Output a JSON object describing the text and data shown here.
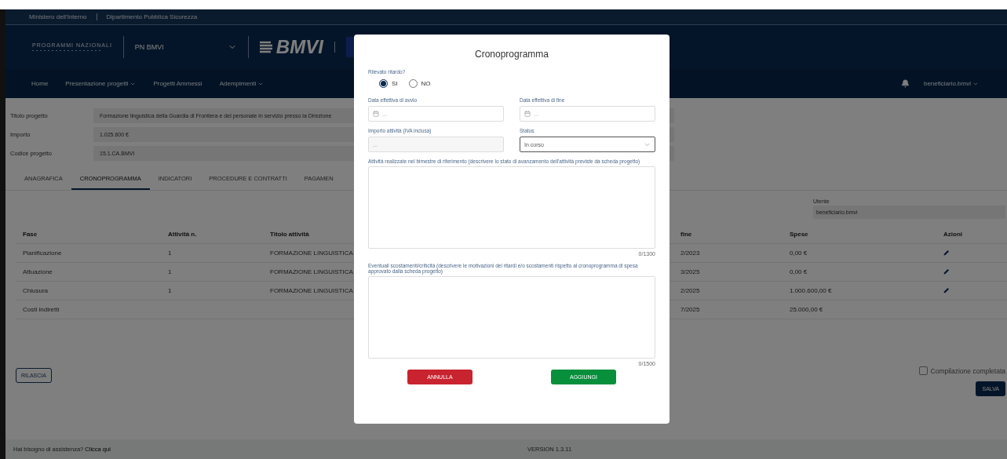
{
  "top_bar": {
    "items": [
      "Ministero dell'Interno",
      "Dipartimento Pubblica Sicurezza"
    ]
  },
  "header": {
    "program_logo": "PROGRAMMI NAZIONALI",
    "program_select": "PN BMVI",
    "brand": "BMVI"
  },
  "nav": {
    "items": [
      {
        "label": "Home",
        "dropdown": false
      },
      {
        "label": "Presentazione progetti",
        "dropdown": true
      },
      {
        "label": "Progetti Ammessi",
        "dropdown": false
      },
      {
        "label": "Adempimenti",
        "dropdown": true
      }
    ],
    "user": "beneficiario.bmvi"
  },
  "project": {
    "fields": [
      {
        "label": "Titolo progetto",
        "value": "Formazione linguistica della Guardia di Frontiera e del personale in servizio presso la Direzione"
      },
      {
        "label": "Importo",
        "value": "1.025.600 €"
      },
      {
        "label": "Codice progetto",
        "value": "15.1.CA.BMVI"
      }
    ]
  },
  "tabs": [
    {
      "label": "ANAGRAFICA",
      "selected": false
    },
    {
      "label": "CRONOPROGRAMMA",
      "selected": true
    },
    {
      "label": "INDICATORI",
      "selected": false
    },
    {
      "label": "PROCEDURE E CONTRATTI",
      "selected": false
    },
    {
      "label": "PAGAMEN",
      "selected": false
    }
  ],
  "user_filter": {
    "label": "Utente",
    "value": "beneficiario.bmvi"
  },
  "table": {
    "columns": [
      "Fase",
      "Attività n.",
      "Titolo attività",
      "fine",
      "Spese",
      "Azioni"
    ],
    "rows": [
      {
        "cells": [
          "Pianificazione",
          "1",
          "FORMAZIONE LINGUISTICA",
          "2/2023",
          "0,00 €"
        ],
        "editable": true
      },
      {
        "cells": [
          "Attuazione",
          "1",
          "FORMAZIONE LINGUISTICA",
          "3/2025",
          "0,00 €"
        ],
        "editable": true
      },
      {
        "cells": [
          "Chiusura",
          "1",
          "FORMAZIONE LINGUISTICA",
          "2/2025",
          "1.000.600,00 €"
        ],
        "editable": true
      },
      {
        "cells": [
          "Costi indiretti",
          "",
          "",
          "7/2025",
          "25.000,00 €"
        ],
        "editable": false
      }
    ]
  },
  "release_button": "RILASCIA",
  "completion": {
    "label": "Compilazione completata",
    "checked": false
  },
  "save_button": "SALVA",
  "footer": {
    "help": "Hai bisogno di assistenza?",
    "link": "Clicca qui",
    "version": "VERSION 1.3.11"
  },
  "modal": {
    "title": "Cronoprogramma",
    "delay": {
      "label": "Rilevato ritardo?",
      "options": [
        {
          "label": "SI",
          "selected": true
        },
        {
          "label": "NO",
          "selected": false
        }
      ]
    },
    "fields": [
      {
        "kind": "date",
        "label": "Data effettiva di avvio",
        "placeholder": "..."
      },
      {
        "kind": "date",
        "label": "Data effettiva di fine",
        "placeholder": "..."
      },
      {
        "kind": "text",
        "label": "Importo attività (IVA inclusa)",
        "placeholder": "..."
      },
      {
        "kind": "select",
        "label": "Status",
        "value": "In corso"
      }
    ],
    "textareas": [
      {
        "label": "Attività realizzate nel bimestre di riferimento (descrivere lo stato di avanzamento dell'attività previste da scheda progetto)",
        "counter": "0/1300"
      },
      {
        "label": "Eventuali scostamenti/criticità (descrivere le motivazioni dei ritardi e/o scostamenti rispetto al cronoprogramma di spesa approvato dalla scheda progetto)",
        "counter": "0/1500"
      }
    ],
    "buttons": [
      {
        "kind": "cancel",
        "label": "ANNULLA"
      },
      {
        "kind": "confirm",
        "label": "AGGIUNGI"
      }
    ]
  }
}
